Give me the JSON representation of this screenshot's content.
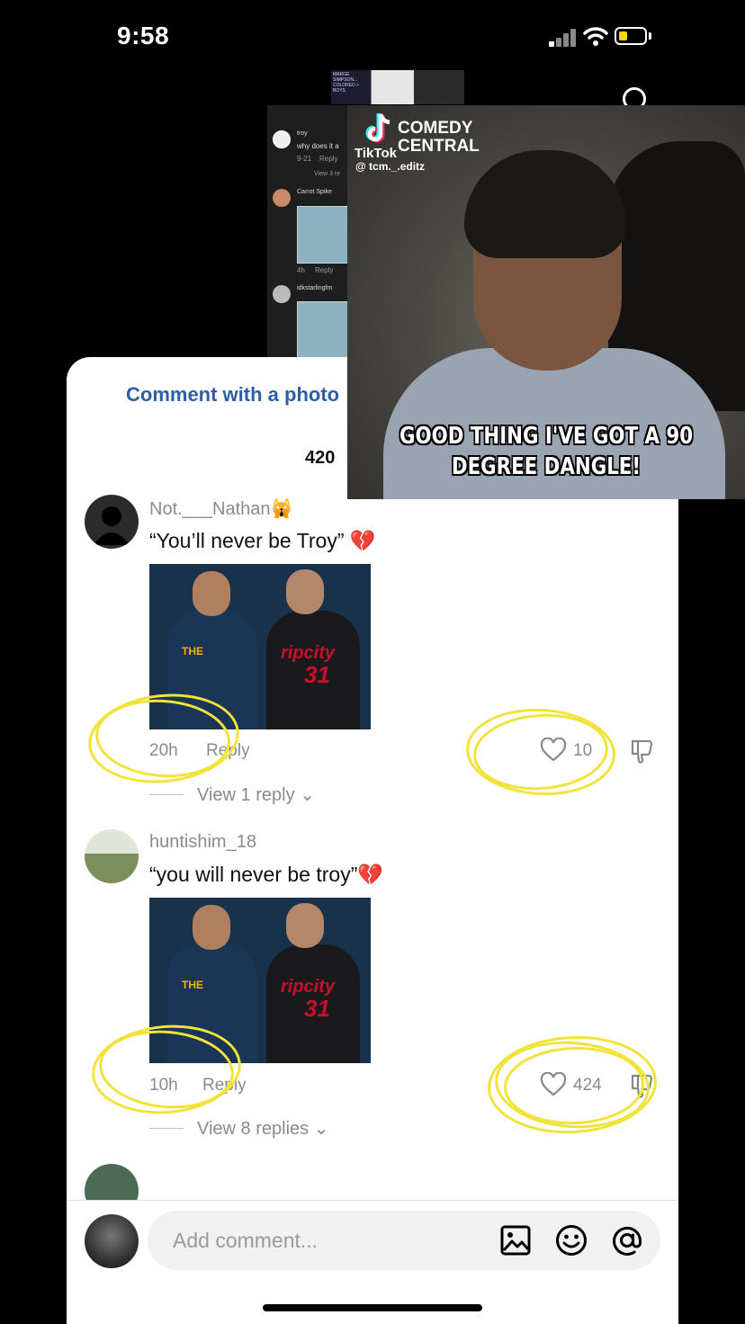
{
  "status_bar": {
    "time": "9:58"
  },
  "background_app": {
    "thumb_text": "MARGE SIMPSON... COLORED > BOYS",
    "mini_comments": [
      {
        "user": "troy",
        "text": "why does it a",
        "time": "9-21",
        "reply": "Reply",
        "view": "View 3 re"
      },
      {
        "user": "Carrot Spike",
        "time": "4h",
        "reply": "Reply"
      },
      {
        "user": "idkstarlingfm"
      }
    ]
  },
  "sheet": {
    "photo_link": "Comment with a photo",
    "comment_count": "420"
  },
  "video": {
    "brand": "TikTok",
    "channel": "COMEDY CENTRAL",
    "username": "@ tcm._.editz",
    "subtitle": "GOOD THING I'VE GOT A 90 DEGREE DANGLE!"
  },
  "comments": [
    {
      "username": "Not.___Nathan🙀",
      "text": "“You’ll never be Troy” 💔",
      "time": "20h",
      "reply": "Reply",
      "likes": "10",
      "view_replies": "View 1 reply ⌄",
      "image_text": {
        "left": "THE",
        "right": "ripcity",
        "number": "31"
      }
    },
    {
      "username": "huntishim_18",
      "text": "“you will never be troy”💔",
      "time": "10h",
      "reply": "Reply",
      "likes": "424",
      "view_replies": "View 8 replies ⌄",
      "image_text": {
        "left": "THE",
        "right": "ripcity",
        "number": "31"
      }
    }
  ],
  "composer": {
    "placeholder": "Add comment..."
  },
  "icons": [
    "signal-icon",
    "wifi-icon",
    "battery-icon",
    "search-icon",
    "heart-icon",
    "dislike-icon",
    "image-icon",
    "emoji-icon",
    "mention-icon"
  ],
  "colors": {
    "highlight": "#f2e33a",
    "link": "#2f5ea8",
    "battery": "#f5d80a"
  }
}
